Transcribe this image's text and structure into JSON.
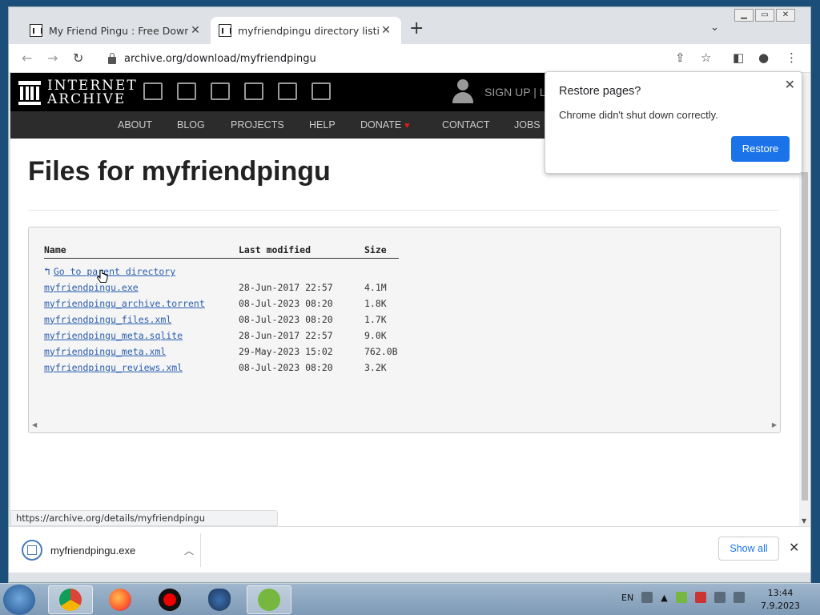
{
  "browser": {
    "tabs": [
      {
        "title": "My Friend Pingu : Free Download",
        "active": false
      },
      {
        "title": "myfriendpingu directory listing",
        "active": true
      }
    ],
    "new_tab": "+",
    "url": "archive.org/download/myfriendpingu",
    "status_url": "https://archive.org/details/myfriendpingu"
  },
  "ia_header": {
    "logo_line1": "INTERNET",
    "logo_line2": "ARCHIVE",
    "signup": "SIGN UP | L",
    "nav": [
      "ABOUT",
      "BLOG",
      "PROJECTS",
      "HELP",
      "DONATE",
      "CONTACT",
      "JOBS"
    ]
  },
  "page": {
    "title": "Files for myfriendpingu",
    "columns": [
      "Name",
      "Last modified",
      "Size"
    ],
    "parent_link": "Go to parent directory",
    "files": [
      {
        "name": "myfriendpingu.exe",
        "modified": "28-Jun-2017 22:57",
        "size": "4.1M"
      },
      {
        "name": "myfriendpingu_archive.torrent",
        "modified": "08-Jul-2023 08:20",
        "size": "1.8K"
      },
      {
        "name": "myfriendpingu_files.xml",
        "modified": "08-Jul-2023 08:20",
        "size": "1.7K"
      },
      {
        "name": "myfriendpingu_meta.sqlite",
        "modified": "28-Jun-2017 22:57",
        "size": "9.0K"
      },
      {
        "name": "myfriendpingu_meta.xml",
        "modified": "29-May-2023 15:02",
        "size": "762.0B"
      },
      {
        "name": "myfriendpingu_reviews.xml",
        "modified": "08-Jul-2023 08:20",
        "size": "3.2K"
      }
    ]
  },
  "popup": {
    "title": "Restore pages?",
    "body": "Chrome didn't shut down correctly.",
    "button": "Restore"
  },
  "downloads": {
    "file": "myfriendpingu.exe",
    "show_all": "Show all"
  },
  "taskbar": {
    "lang": "EN",
    "time": "13:44",
    "date": "7.9.2023"
  }
}
